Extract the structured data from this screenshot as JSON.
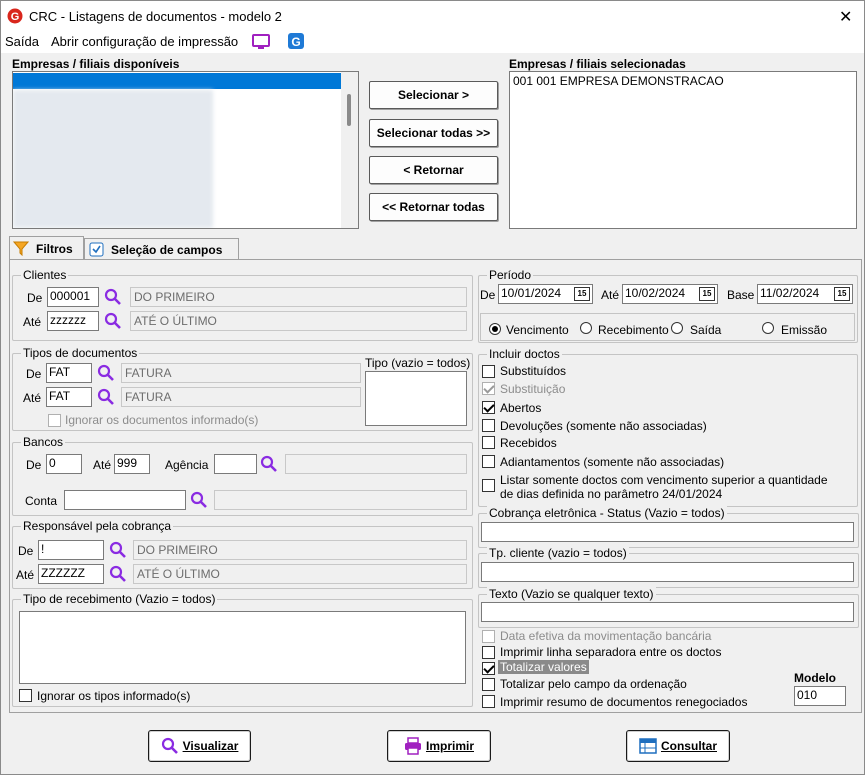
{
  "window": {
    "title": "CRC - Listagens de documentos - modelo 2",
    "close": "✕"
  },
  "menu": {
    "exit": "Saída",
    "print_config": "Abrir configuração de impressão"
  },
  "companies": {
    "available_label": "Empresas / filiais disponíveis",
    "selected_label": "Empresas / filiais selecionadas",
    "selected_items": [
      "001 001 EMPRESA DEMONSTRACAO"
    ],
    "buttons": {
      "select": "Selecionar >",
      "select_all": "Selecionar todas >>",
      "return": "< Retornar",
      "return_all": "<< Retornar todas"
    }
  },
  "tabs": {
    "filters": "Filtros",
    "fields": "Seleção de campos"
  },
  "clients": {
    "label": "Clientes",
    "from_label": "De",
    "from_value": "000001",
    "from_desc": "DO PRIMEIRO",
    "to_label": "Até",
    "to_value": "zzzzzz",
    "to_desc": "ATÉ O ÚLTIMO"
  },
  "doc_types": {
    "label": "Tipos de documentos",
    "from_label": "De",
    "from_value": "FAT",
    "from_desc": "FATURA",
    "to_label": "Até",
    "to_value": "FAT",
    "to_desc": "FATURA",
    "ignore": "Ignorar os documentos informado(s)",
    "type_label": "Tipo (vazio = todos)"
  },
  "banks": {
    "label": "Bancos",
    "from_label": "De",
    "from_value": "0",
    "to_label": "Até",
    "to_value": "999",
    "agency_label": "Agência",
    "agency_value": "",
    "account_label": "Conta",
    "account_value": ""
  },
  "responsible": {
    "label": "Responsável pela cobrança",
    "from_label": "De",
    "from_value": "!",
    "from_desc": "DO PRIMEIRO",
    "to_label": "Até",
    "to_value": "ZZZZZZ",
    "to_desc": "ATÉ O ÚLTIMO"
  },
  "receipt_type": {
    "label": "Tipo de recebimento (Vazio = todos)",
    "ignore": "Ignorar os tipos informado(s)"
  },
  "period": {
    "label": "Período",
    "from_label": "De",
    "from_value": "10/01/2024",
    "to_label": "Até",
    "to_value": "10/02/2024",
    "base_label": "Base",
    "base_value": "11/02/2024",
    "cal_icon": "15",
    "options": [
      "Vencimento",
      "Recebimento",
      "Saída",
      "Emissão"
    ],
    "selected": "Vencimento"
  },
  "include": {
    "label": "Incluir doctos",
    "items": [
      {
        "label": "Substituídos",
        "checked": false,
        "disabled": false
      },
      {
        "label": "Substituição",
        "checked": true,
        "disabled": true
      },
      {
        "label": "Abertos",
        "checked": true,
        "disabled": false
      },
      {
        "label": "Devoluções (somente não associadas)",
        "checked": false,
        "disabled": false
      },
      {
        "label": "Recebidos",
        "checked": false,
        "disabled": false
      },
      {
        "label": "Adiantamentos (somente não associadas)",
        "checked": false,
        "disabled": false
      }
    ],
    "long_line1": "Listar somente doctos com vencimento superior a quantidade",
    "long_line2": "de dias definida no parâmetro 24/01/2024"
  },
  "ebilling": {
    "label": "Cobrança eletrônica - Status (Vazio = todos)",
    "value": ""
  },
  "client_type": {
    "label": "Tp. cliente (vazio = todos)",
    "value": ""
  },
  "text_filter": {
    "label": "Texto (Vazio se qualquer texto)",
    "value": ""
  },
  "options": {
    "effective_date": "Data efetiva da movimentação bancária",
    "separator": "Imprimir linha separadora entre os doctos",
    "totalize": "Totalizar valores",
    "totalize_order": "Totalizar pelo campo da ordenação",
    "renegotiated": "Imprimir resumo de documentos renegociados"
  },
  "model": {
    "label": "Modelo",
    "value": "010"
  },
  "actions": {
    "view": "Visualizar",
    "print": "Imprimir",
    "query": "Consultar"
  },
  "colors": {
    "accent": "#8a2be2",
    "brand_red": "#d9261c",
    "selection": "#0078d7"
  }
}
